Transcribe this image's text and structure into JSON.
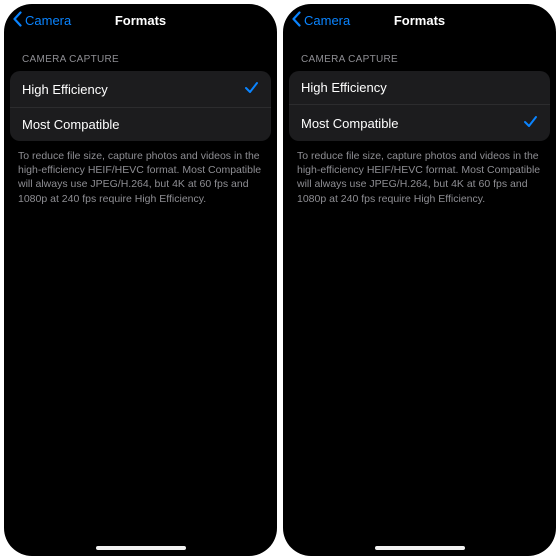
{
  "screens": [
    {
      "back_label": "Camera",
      "title": "Formats",
      "section_header": "CAMERA CAPTURE",
      "options": [
        {
          "label": "High Efficiency",
          "selected": true
        },
        {
          "label": "Most Compatible",
          "selected": false
        }
      ],
      "footer": "To reduce file size, capture photos and videos in the high-efficiency HEIF/HEVC format. Most Compatible will always use JPEG/H.264, but 4K at 60 fps and 1080p at 240 fps require High Efficiency."
    },
    {
      "back_label": "Camera",
      "title": "Formats",
      "section_header": "CAMERA CAPTURE",
      "options": [
        {
          "label": "High Efficiency",
          "selected": false
        },
        {
          "label": "Most Compatible",
          "selected": true
        }
      ],
      "footer": "To reduce file size, capture photos and videos in the high-efficiency HEIF/HEVC format. Most Compatible will always use JPEG/H.264, but 4K at 60 fps and 1080p at 240 fps require High Efficiency."
    }
  ],
  "colors": {
    "accent": "#0a84ff",
    "row_bg": "#1c1c1e",
    "muted": "#8e8e93"
  }
}
